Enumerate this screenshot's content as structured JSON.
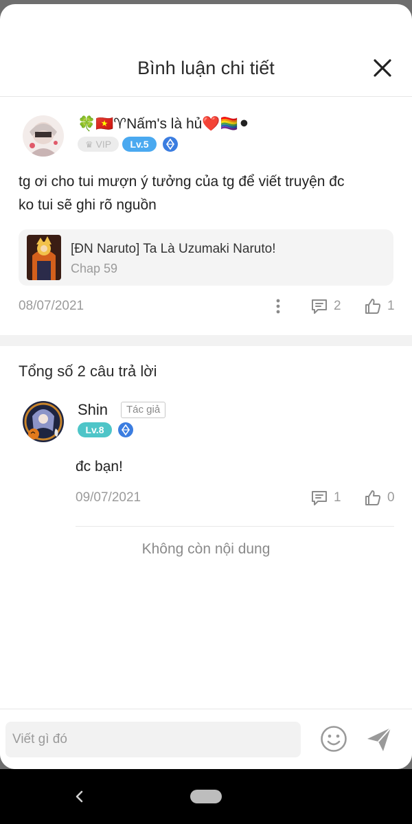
{
  "header": {
    "title": "Bình luận chi tiết",
    "close_icon": "close-icon"
  },
  "comment": {
    "username": "🍀🇻🇳♈Nấm's là hủ❤️🏳️‍🌈⚫",
    "vip_label": "VIP",
    "level_label": "Lv.5",
    "text_line1": "tg ơi cho tui mượn ý tưởng của tg để viết truyện đc",
    "text_line2": "ko tui sẽ ghi rõ nguồn",
    "story": {
      "title": "[ĐN Naruto] Ta Là Uzumaki Naruto!",
      "chapter": "Chap 59"
    },
    "date": "08/07/2021",
    "reply_count": "2",
    "like_count": "1"
  },
  "replies": {
    "total_label": "Tổng số 2 câu trả lời",
    "items": [
      {
        "username": "Shin",
        "author_tag": "Tác giả",
        "level_label": "Lv.8",
        "text": "đc bạn!",
        "date": "09/07/2021",
        "reply_count": "1",
        "like_count": "0"
      }
    ],
    "end_label": "Không còn nội dung"
  },
  "input": {
    "placeholder": "Viết gì đó"
  },
  "colors": {
    "accent": "#4aa9f0",
    "level8": "#4ec5c8",
    "muted": "#9b9b9b"
  }
}
